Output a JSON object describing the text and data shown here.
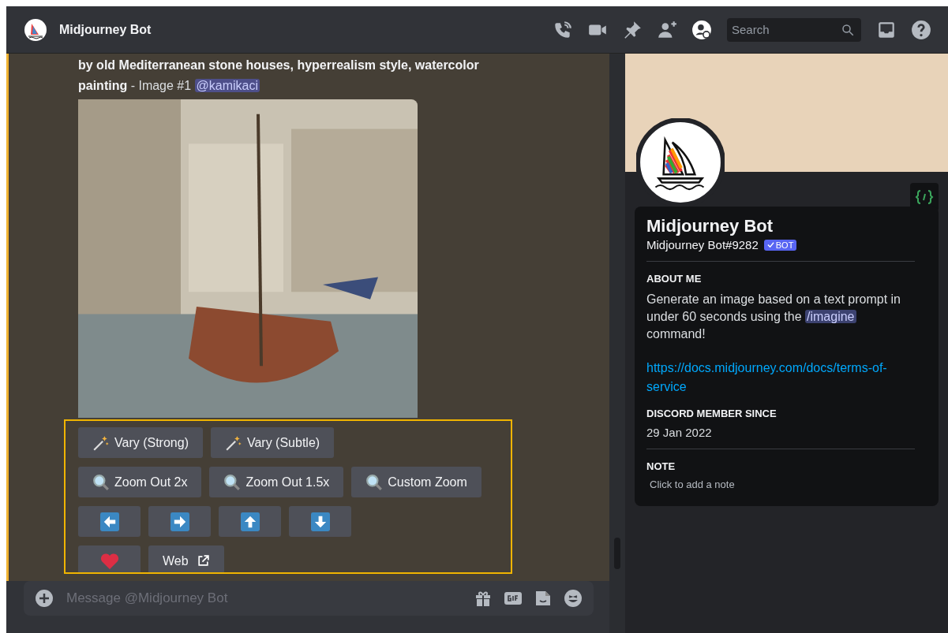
{
  "header": {
    "title": "Midjourney Bot",
    "search": {
      "placeholder": "Search"
    }
  },
  "message": {
    "prompt_line": "by old Mediterranean stone houses, hyperrealism style, watercolor",
    "prompt_end": "painting",
    "suffix": "- Image #1",
    "mention": "@kamikaci"
  },
  "button_rows": [
    [
      {
        "kind": "wand",
        "label": "Vary (Strong)"
      },
      {
        "kind": "wand",
        "label": "Vary (Subtle)"
      }
    ],
    [
      {
        "kind": "magnifier",
        "label": "Zoom Out 2x"
      },
      {
        "kind": "magnifier",
        "label": "Zoom Out 1.5x"
      },
      {
        "kind": "magnifier",
        "label": "Custom Zoom"
      }
    ],
    [
      {
        "kind": "left"
      },
      {
        "kind": "right"
      },
      {
        "kind": "up"
      },
      {
        "kind": "down"
      }
    ],
    [
      {
        "kind": "heart"
      },
      {
        "kind": "external",
        "label": "Web"
      }
    ]
  ],
  "composer": {
    "placeholder": "Message @Midjourney Bot"
  },
  "profile": {
    "name": "Midjourney Bot",
    "tag": "Midjourney Bot#9282",
    "badge": "BOT",
    "about_heading": "ABOUT ME",
    "about_before": "Generate an image based on a text prompt in under 60 seconds using the",
    "command": "/imagine",
    "about_after": "command!",
    "link": "https://docs.midjourney.com/docs/terms-of-service",
    "since_heading": "DISCORD MEMBER SINCE",
    "since": "29 Jan 2022",
    "note_heading": "NOTE",
    "note_placeholder": "Click to add a note"
  }
}
